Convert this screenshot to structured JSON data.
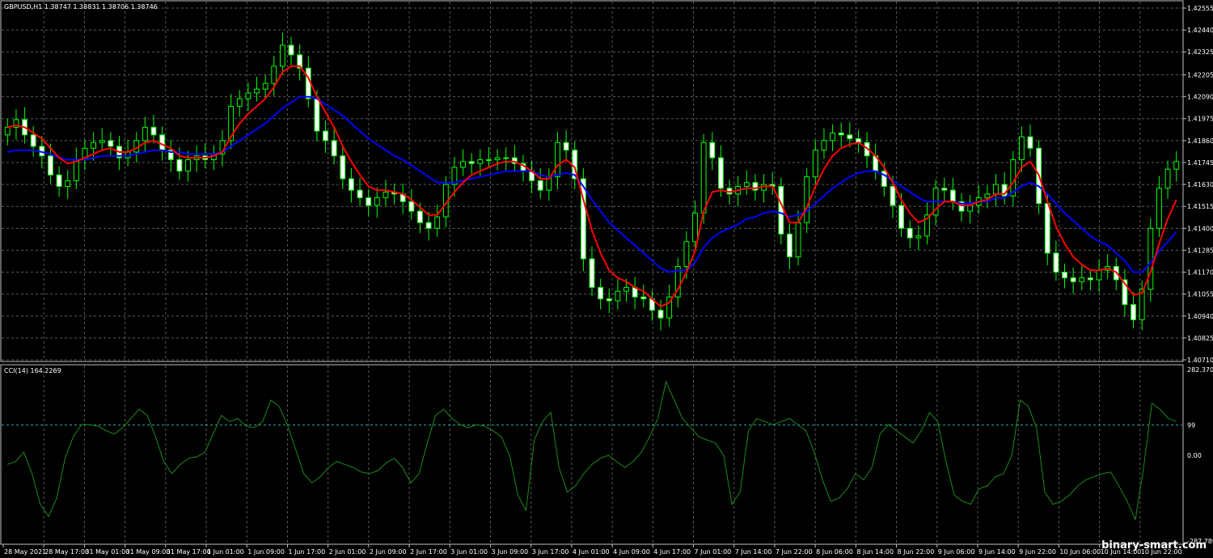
{
  "main_panel": {
    "title": "GBPUSD,H1  1.38747 1.38831 1.38706 1.38746"
  },
  "indicator_panel": {
    "title": "CCI(14) 164.2269"
  },
  "colors": {
    "background": "#000000",
    "grid": "#5a5a5a",
    "bull_candle": "#00ff00",
    "bear_candle": "#ffffff",
    "fast_ma": "#ff0000",
    "slow_ma": "#0000ff",
    "cci_line": "#1a8a1a",
    "level_line": "#2aa3a3"
  },
  "watermark": "binary-smart.com",
  "chart_data": [
    {
      "type": "candlestick",
      "symbol": "GBPUSD",
      "timeframe": "H1",
      "y_ticks": [
        "1.42555",
        "1.42440",
        "1.42325",
        "1.42205",
        "1.42090",
        "1.41975",
        "1.41860",
        "1.41745",
        "1.41630",
        "1.41515",
        "1.41400",
        "1.41285",
        "1.41170",
        "1.41055",
        "1.40940",
        "1.40825",
        "1.40710"
      ],
      "ylim": [
        1.4071,
        1.42555
      ],
      "close": [
        1.4193,
        1.4197,
        1.4189,
        1.4183,
        1.4178,
        1.4168,
        1.4162,
        1.4165,
        1.4176,
        1.4182,
        1.4185,
        1.4186,
        1.4183,
        1.4177,
        1.418,
        1.4186,
        1.4193,
        1.4189,
        1.4181,
        1.4176,
        1.417,
        1.4176,
        1.4178,
        1.4176,
        1.4179,
        1.4186,
        1.4204,
        1.4208,
        1.4211,
        1.4213,
        1.4216,
        1.4225,
        1.4236,
        1.4231,
        1.4224,
        1.4208,
        1.4191,
        1.4186,
        1.4178,
        1.4166,
        1.416,
        1.4156,
        1.4152,
        1.4156,
        1.4159,
        1.4158,
        1.4154,
        1.4149,
        1.4143,
        1.414,
        1.4146,
        1.4163,
        1.4172,
        1.4175,
        1.4174,
        1.4176,
        1.4176,
        1.4177,
        1.4177,
        1.4174,
        1.417,
        1.4165,
        1.416,
        1.4167,
        1.4185,
        1.4181,
        1.4166,
        1.4124,
        1.4109,
        1.4103,
        1.4102,
        1.4107,
        1.4109,
        1.4104,
        1.4103,
        1.4097,
        1.4093,
        1.4104,
        1.412,
        1.4133,
        1.4148,
        1.4185,
        1.4177,
        1.4161,
        1.4158,
        1.4162,
        1.4164,
        1.416,
        1.4163,
        1.4162,
        1.4137,
        1.4125,
        1.4143,
        1.4167,
        1.4181,
        1.4186,
        1.419,
        1.4189,
        1.4187,
        1.4185,
        1.4178,
        1.417,
        1.4162,
        1.4152,
        1.414,
        1.4135,
        1.4136,
        1.4147,
        1.4161,
        1.416,
        1.4154,
        1.4149,
        1.4152,
        1.4156,
        1.4158,
        1.4163,
        1.4157,
        1.4176,
        1.4188,
        1.4182,
        1.4153,
        1.4127,
        1.4117,
        1.4114,
        1.4112,
        1.4114,
        1.4113,
        1.4118,
        1.412,
        1.4113,
        1.41,
        1.4092,
        1.4108,
        1.414,
        1.4161,
        1.4171,
        1.4175
      ],
      "fast_ma_values": [
        1.4193,
        1.4194,
        1.4193,
        1.419,
        1.4187,
        1.4182,
        1.4177,
        1.4174,
        1.4175,
        1.4177,
        1.4179,
        1.4181,
        1.4182,
        1.418,
        1.418,
        1.4182,
        1.4185,
        1.4186,
        1.4184,
        1.4182,
        1.4178,
        1.4177,
        1.4177,
        1.4177,
        1.4178,
        1.418,
        1.4188,
        1.4195,
        1.42,
        1.4204,
        1.4208,
        1.4214,
        1.4222,
        1.4225,
        1.4225,
        1.4219,
        1.4209,
        1.4201,
        1.4193,
        1.4183,
        1.4175,
        1.4168,
        1.4162,
        1.416,
        1.416,
        1.4159,
        1.4158,
        1.4155,
        1.4151,
        1.4147,
        1.4147,
        1.4153,
        1.4159,
        1.4164,
        1.4168,
        1.417,
        1.4172,
        1.4174,
        1.4175,
        1.4175,
        1.4173,
        1.417,
        1.4166,
        1.4166,
        1.4173,
        1.4176,
        1.4172,
        1.4155,
        1.4139,
        1.4127,
        1.4118,
        1.4114,
        1.4112,
        1.4109,
        1.4107,
        1.4103,
        1.4099,
        1.4101,
        1.4108,
        1.4117,
        1.4128,
        1.4149,
        1.4159,
        1.416,
        1.4159,
        1.416,
        1.4161,
        1.4161,
        1.4162,
        1.4162,
        1.4153,
        1.4143,
        1.4143,
        1.4151,
        1.4162,
        1.4171,
        1.4178,
        1.4182,
        1.4184,
        1.4185,
        1.4182,
        1.4178,
        1.4172,
        1.4164,
        1.4155,
        1.4148,
        1.4143,
        1.4145,
        1.415,
        1.4154,
        1.4154,
        1.4152,
        1.4152,
        1.4154,
        1.4155,
        1.4158,
        1.4158,
        1.4164,
        1.4172,
        1.4175,
        1.4168,
        1.4154,
        1.4141,
        1.4132,
        1.4125,
        1.4121,
        1.4118,
        1.4118,
        1.4119,
        1.4117,
        1.4111,
        1.4105,
        1.4106,
        1.4117,
        1.4132,
        1.4145,
        1.4155
      ],
      "slow_ma_values": [
        1.418,
        1.4181,
        1.4181,
        1.4181,
        1.418,
        1.4179,
        1.4177,
        1.4176,
        1.4176,
        1.4176,
        1.4177,
        1.4178,
        1.4178,
        1.4178,
        1.4178,
        1.4179,
        1.418,
        1.4181,
        1.4181,
        1.418,
        1.418,
        1.4179,
        1.4179,
        1.4179,
        1.4179,
        1.418,
        1.4183,
        1.4186,
        1.4189,
        1.4192,
        1.4195,
        1.4199,
        1.4203,
        1.4206,
        1.4209,
        1.4209,
        1.4208,
        1.4205,
        1.4202,
        1.4199,
        1.4195,
        1.4191,
        1.4187,
        1.4184,
        1.4181,
        1.4178,
        1.4176,
        1.4173,
        1.417,
        1.4167,
        1.4164,
        1.4164,
        1.4164,
        1.4165,
        1.4166,
        1.4167,
        1.4168,
        1.4169,
        1.417,
        1.417,
        1.417,
        1.417,
        1.4168,
        1.4167,
        1.4168,
        1.4169,
        1.4168,
        1.4162,
        1.4155,
        1.4149,
        1.4143,
        1.4139,
        1.4135,
        1.4131,
        1.4127,
        1.4123,
        1.4119,
        1.4117,
        1.4118,
        1.4118,
        1.4122,
        1.413,
        1.4135,
        1.4138,
        1.414,
        1.4142,
        1.4145,
        1.4146,
        1.4148,
        1.4149,
        1.4148,
        1.4146,
        1.4147,
        1.4149,
        1.4153,
        1.4157,
        1.4161,
        1.4164,
        1.4167,
        1.4169,
        1.417,
        1.417,
        1.4168,
        1.4165,
        1.4162,
        1.4159,
        1.4156,
        1.4154,
        1.4154,
        1.4154,
        1.4154,
        1.4153,
        1.4153,
        1.4154,
        1.4154,
        1.4156,
        1.4156,
        1.4159,
        1.4162,
        1.4164,
        1.4162,
        1.4158,
        1.4153,
        1.4148,
        1.4144,
        1.414,
        1.4136,
        1.4133,
        1.4131,
        1.4127,
        1.4123,
        1.4117,
        1.4117,
        1.4122,
        1.4128,
        1.4133,
        1.4138
      ]
    },
    {
      "type": "line",
      "name": "CCI(14)",
      "current_value": 164.2269,
      "y_ticks": [
        "282.3703",
        "99",
        "0.00",
        "-287.7896"
      ],
      "ylim": [
        -287.7896,
        282.3703
      ],
      "level": 99,
      "values": [
        -30,
        -20,
        10,
        -60,
        -160,
        -200,
        -140,
        -10,
        60,
        100,
        100,
        95,
        80,
        70,
        90,
        120,
        150,
        130,
        60,
        -20,
        -60,
        -30,
        -10,
        -5,
        10,
        70,
        130,
        110,
        120,
        95,
        90,
        110,
        180,
        160,
        100,
        20,
        -60,
        -90,
        -70,
        -40,
        -20,
        -30,
        -40,
        -55,
        -60,
        -50,
        -25,
        -10,
        -40,
        -90,
        -60,
        40,
        130,
        150,
        120,
        100,
        90,
        100,
        95,
        80,
        60,
        0,
        -130,
        -180,
        50,
        110,
        140,
        -40,
        -120,
        -100,
        -60,
        -30,
        -10,
        0,
        -20,
        -40,
        -20,
        10,
        60,
        120,
        240,
        180,
        120,
        90,
        60,
        50,
        40,
        0,
        -160,
        -120,
        80,
        120,
        110,
        100,
        110,
        120,
        100,
        80,
        10,
        -80,
        -150,
        -140,
        -110,
        -60,
        -80,
        -40,
        70,
        100,
        80,
        60,
        40,
        80,
        140,
        110,
        -20,
        -130,
        -150,
        -160,
        -110,
        -100,
        -70,
        -60,
        0,
        180,
        160,
        90,
        -120,
        -160,
        -150,
        -130,
        -100,
        -80,
        -70,
        -60,
        -55,
        -100,
        -150,
        -210,
        -40,
        170,
        150,
        120,
        110
      ]
    }
  ],
  "x_axis_labels": [
    "28 May 2021",
    "28 May 17:00",
    "31 May 01:00",
    "31 May 09:00",
    "31 May 17:00",
    "1 Jun 01:00",
    "1 Jun 09:00",
    "1 Jun 17:00",
    "2 Jun 01:00",
    "2 Jun 09:00",
    "2 Jun 17:00",
    "3 Jun 01:00",
    "3 Jun 09:00",
    "3 Jun 17:00",
    "4 Jun 01:00",
    "4 Jun 09:00",
    "4 Jun 17:00",
    "7 Jun 01:00",
    "7 Jun 14:00",
    "7 Jun 22:00",
    "8 Jun 06:00",
    "8 Jun 14:00",
    "8 Jun 22:00",
    "9 Jun 06:00",
    "9 Jun 14:00",
    "9 Jun 22:00",
    "10 Jun 06:00",
    "10 Jun 14:00",
    "10 Jun 22:00"
  ]
}
